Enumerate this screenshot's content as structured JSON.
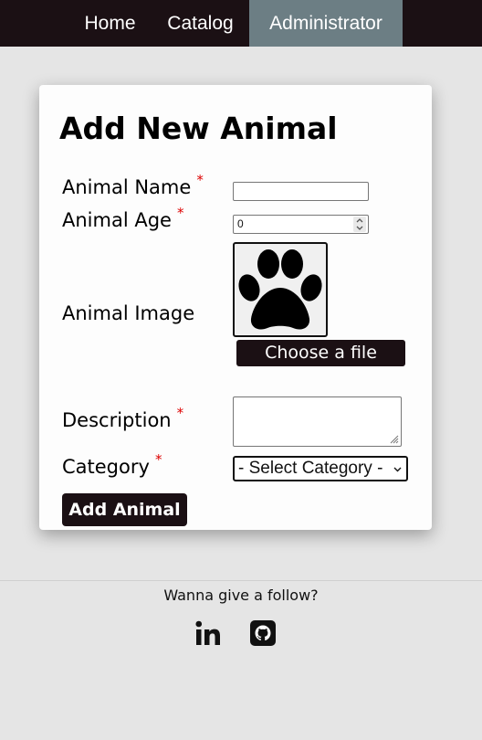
{
  "nav": {
    "items": [
      {
        "label": "Home"
      },
      {
        "label": "Catalog"
      },
      {
        "label": "Administrator",
        "active": true
      }
    ],
    "active_color": "#6c7e84",
    "background_color": "#1b1014"
  },
  "form": {
    "title": "Add New Animal",
    "required_marker": "*",
    "name_label": "Animal Name",
    "name_value": "",
    "age_label": "Animal Age",
    "age_value": "0",
    "image_label": "Animal Image",
    "image_placeholder_icon": "paw-print-icon",
    "file_button_label": "Choose a file",
    "description_label": "Description",
    "description_value": "",
    "category_label": "Category",
    "category_selected": "- Select Category -",
    "submit_label": "Add Animal"
  },
  "footer": {
    "text": "Wanna give a follow?",
    "social": [
      {
        "icon": "linkedin-icon"
      },
      {
        "icon": "github-icon"
      }
    ]
  }
}
